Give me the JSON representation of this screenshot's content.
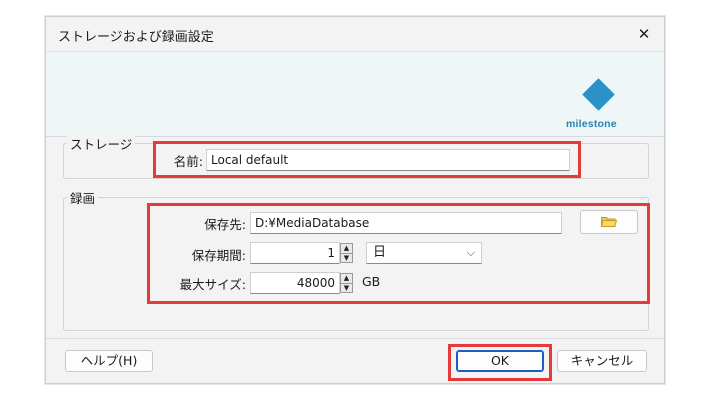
{
  "window": {
    "title": "ストレージおよび録画設定",
    "close_glyph": "✕"
  },
  "banner": {
    "logo_text": "milestone",
    "brand_color": "#2a92c8"
  },
  "storage_group": {
    "label": "ストレージ",
    "name_label": "名前:",
    "name_value": "Local default"
  },
  "recording_group": {
    "label": "録画",
    "path_label": "保存先:",
    "path_value": "D:¥MediaDatabase",
    "browse_icon": "folder-icon",
    "retention_label": "保存期間:",
    "retention_value": "1",
    "retention_unit": "日",
    "maxsize_label": "最大サイズ:",
    "maxsize_value": "48000",
    "maxsize_unit": "GB"
  },
  "buttons": {
    "help": "ヘルプ(H)",
    "ok": "OK",
    "cancel": "キャンセル"
  },
  "highlight_color": "#e53a3a"
}
